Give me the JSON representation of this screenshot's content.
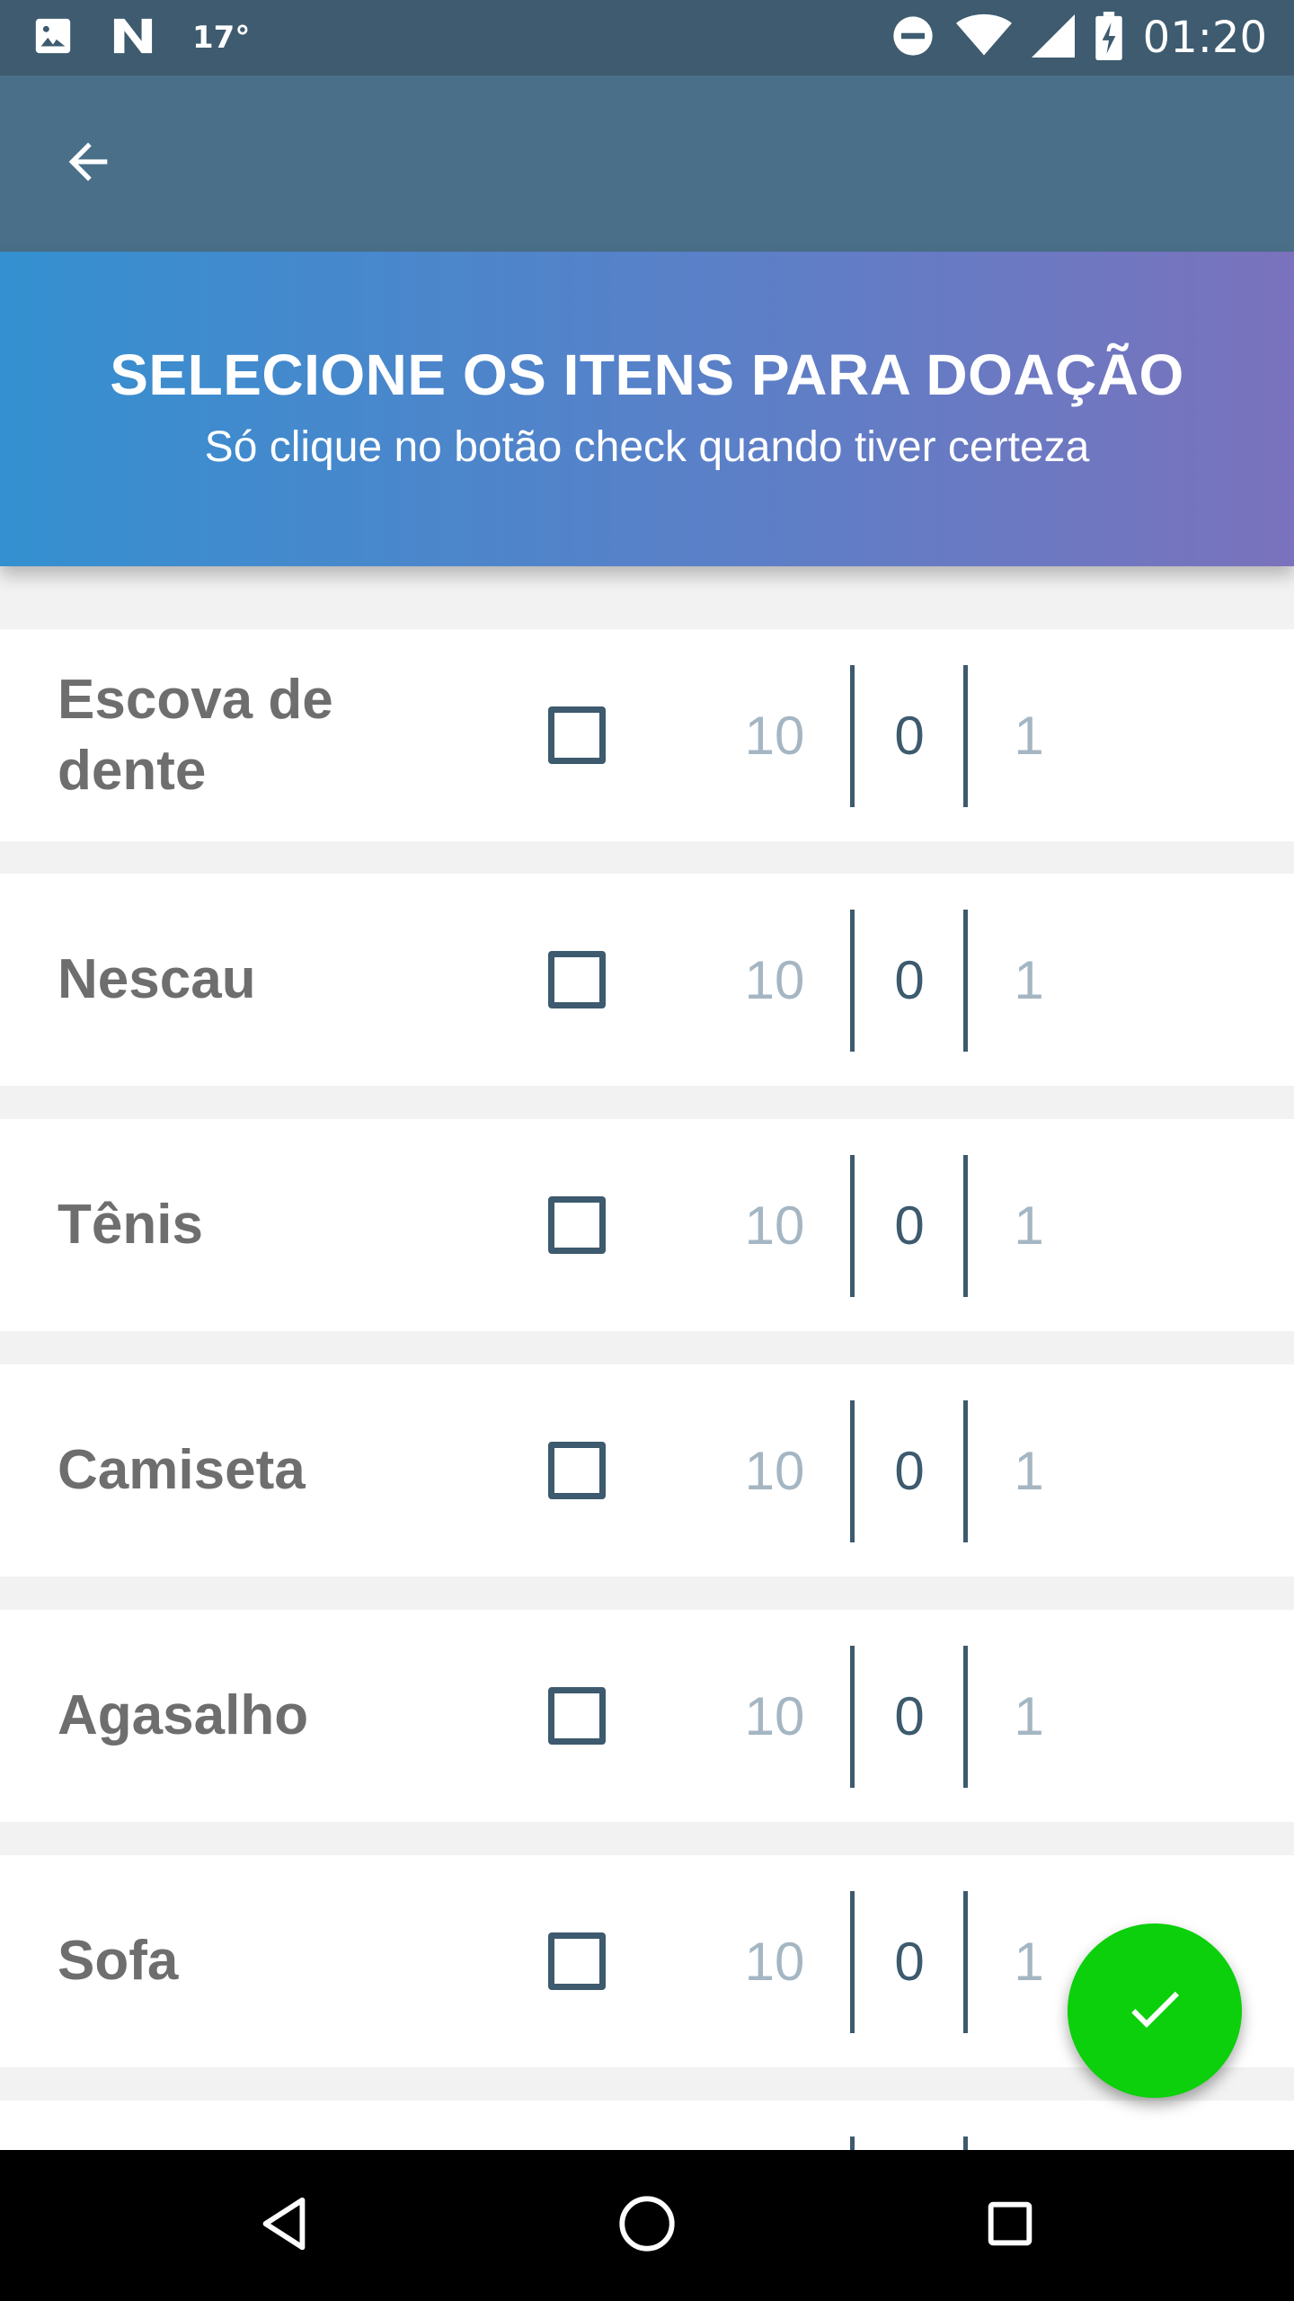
{
  "status_bar": {
    "temperature": "17°",
    "time": "01:20",
    "icons": [
      "image-icon",
      "n-app-icon",
      "do-not-disturb-icon",
      "wifi-icon",
      "signal-icon",
      "battery-charging-icon"
    ]
  },
  "app_bar": {
    "back_icon": "arrow-left-icon"
  },
  "header": {
    "title": "SELECIONE OS ITENS PARA DOAÇÃO",
    "subtitle": "Só clique no botão check quando tiver certeza"
  },
  "items": [
    {
      "name": "Escova de dente",
      "checked": false,
      "prev": "10",
      "value": "0",
      "next": "1"
    },
    {
      "name": "Nescau",
      "checked": false,
      "prev": "10",
      "value": "0",
      "next": "1"
    },
    {
      "name": "Tênis",
      "checked": false,
      "prev": "10",
      "value": "0",
      "next": "1"
    },
    {
      "name": "Camiseta",
      "checked": false,
      "prev": "10",
      "value": "0",
      "next": "1"
    },
    {
      "name": "Agasalho",
      "checked": false,
      "prev": "10",
      "value": "0",
      "next": "1"
    },
    {
      "name": "Sofa",
      "checked": false,
      "prev": "10",
      "value": "0",
      "next": "1"
    }
  ],
  "fab": {
    "icon": "check-icon",
    "color": "#0bd00b"
  },
  "nav_bar": {
    "icons": [
      "back-triangle-icon",
      "home-circle-icon",
      "recents-square-icon"
    ]
  },
  "colors": {
    "status_bar": "#3e5b6f",
    "app_bar": "#4a7089",
    "accent": "#3d5a6e"
  }
}
